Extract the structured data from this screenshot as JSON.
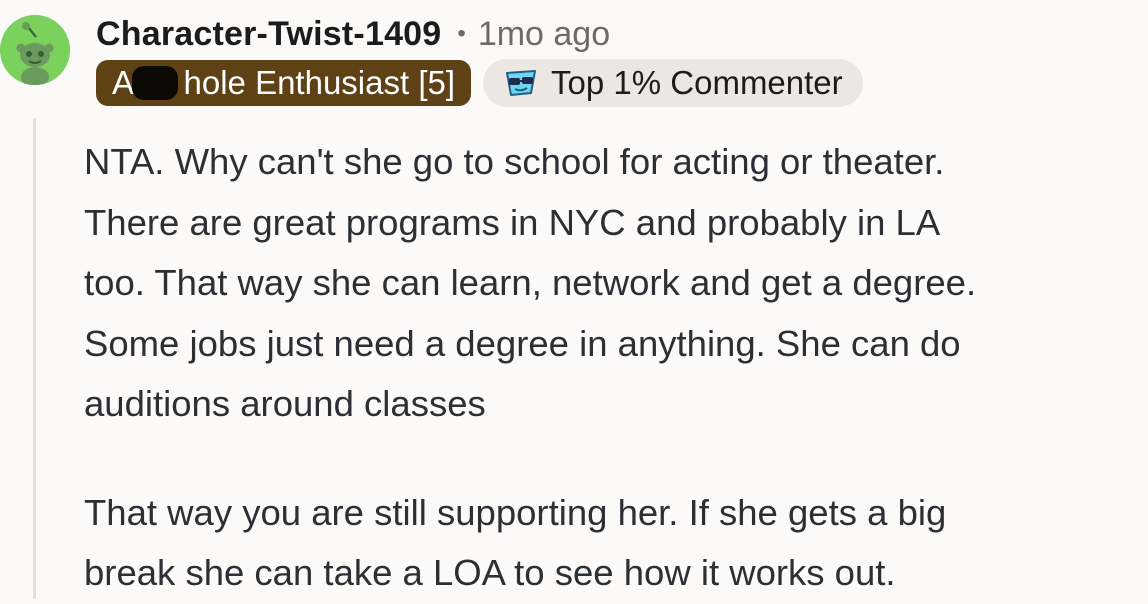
{
  "comment": {
    "author": "Character-Twist-1409",
    "separator": "•",
    "timestamp": "1mo ago",
    "avatar_icon": "snoo-avatar-icon",
    "avatar_color": "#7ad15c",
    "user_flair": "A   hole Enthusiast [5]",
    "user_flair_color": "#5e4216",
    "achievement_badge": {
      "icon": "sunglasses-badge-icon",
      "label": "Top 1% Commenter"
    },
    "body_lines": [
      "NTA. Why can't she go to school for acting or theater.",
      "There are great programs in NYC and probably in LA",
      "too. That way she can learn, network and get a degree.",
      "Some jobs just need a degree in anything. She can do",
      "auditions around classes",
      "That way you are still supporting her. If she gets a big",
      "break she can take a LOA to see how it works out."
    ]
  }
}
